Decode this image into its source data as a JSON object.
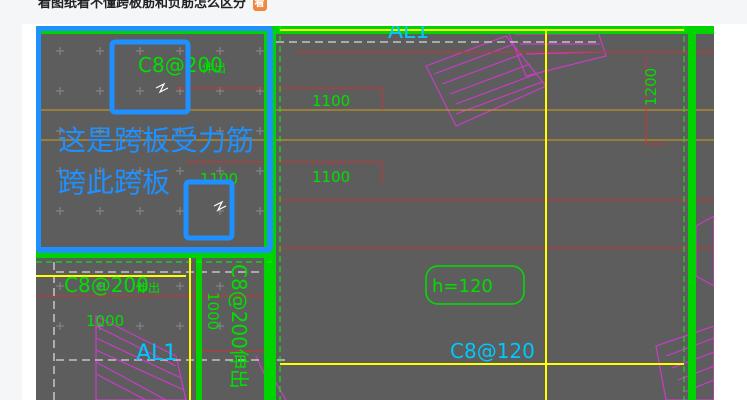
{
  "caption": {
    "text": "看图纸看不懂跨板筋和负筋怎么区分",
    "badge": "看"
  },
  "cad": {
    "labels": {
      "rebar_top_left": "C8@200",
      "rebar_top_left_suffix": "伸出",
      "dim_1100_a": "1100",
      "dim_1100_b": "1100",
      "dim_1100_c": "1100",
      "dim_1200": "1200",
      "al1_top": "AL1",
      "rebar_mid_left": "C8@200",
      "rebar_mid_left_suffix": "伸出",
      "dim_1000_a": "1000",
      "dim_1000_b": "1000",
      "rebar_vertical": "C8@200伸出",
      "al1_bottom": "AL1",
      "slab_tag": "h=120",
      "rebar_bottom": "C8@120"
    },
    "annotation": {
      "line1": "这是跨板受力筋",
      "line2": "跨此跨板"
    }
  },
  "colors": {
    "background": "#5a5a5a",
    "green": "#00e000",
    "yellow": "#ffff00",
    "red": "#ff3333",
    "magenta": "#d040d0",
    "cyan": "#00c8ff",
    "annotation_blue": "#1e90ff",
    "white_dash": "#dddddd"
  }
}
